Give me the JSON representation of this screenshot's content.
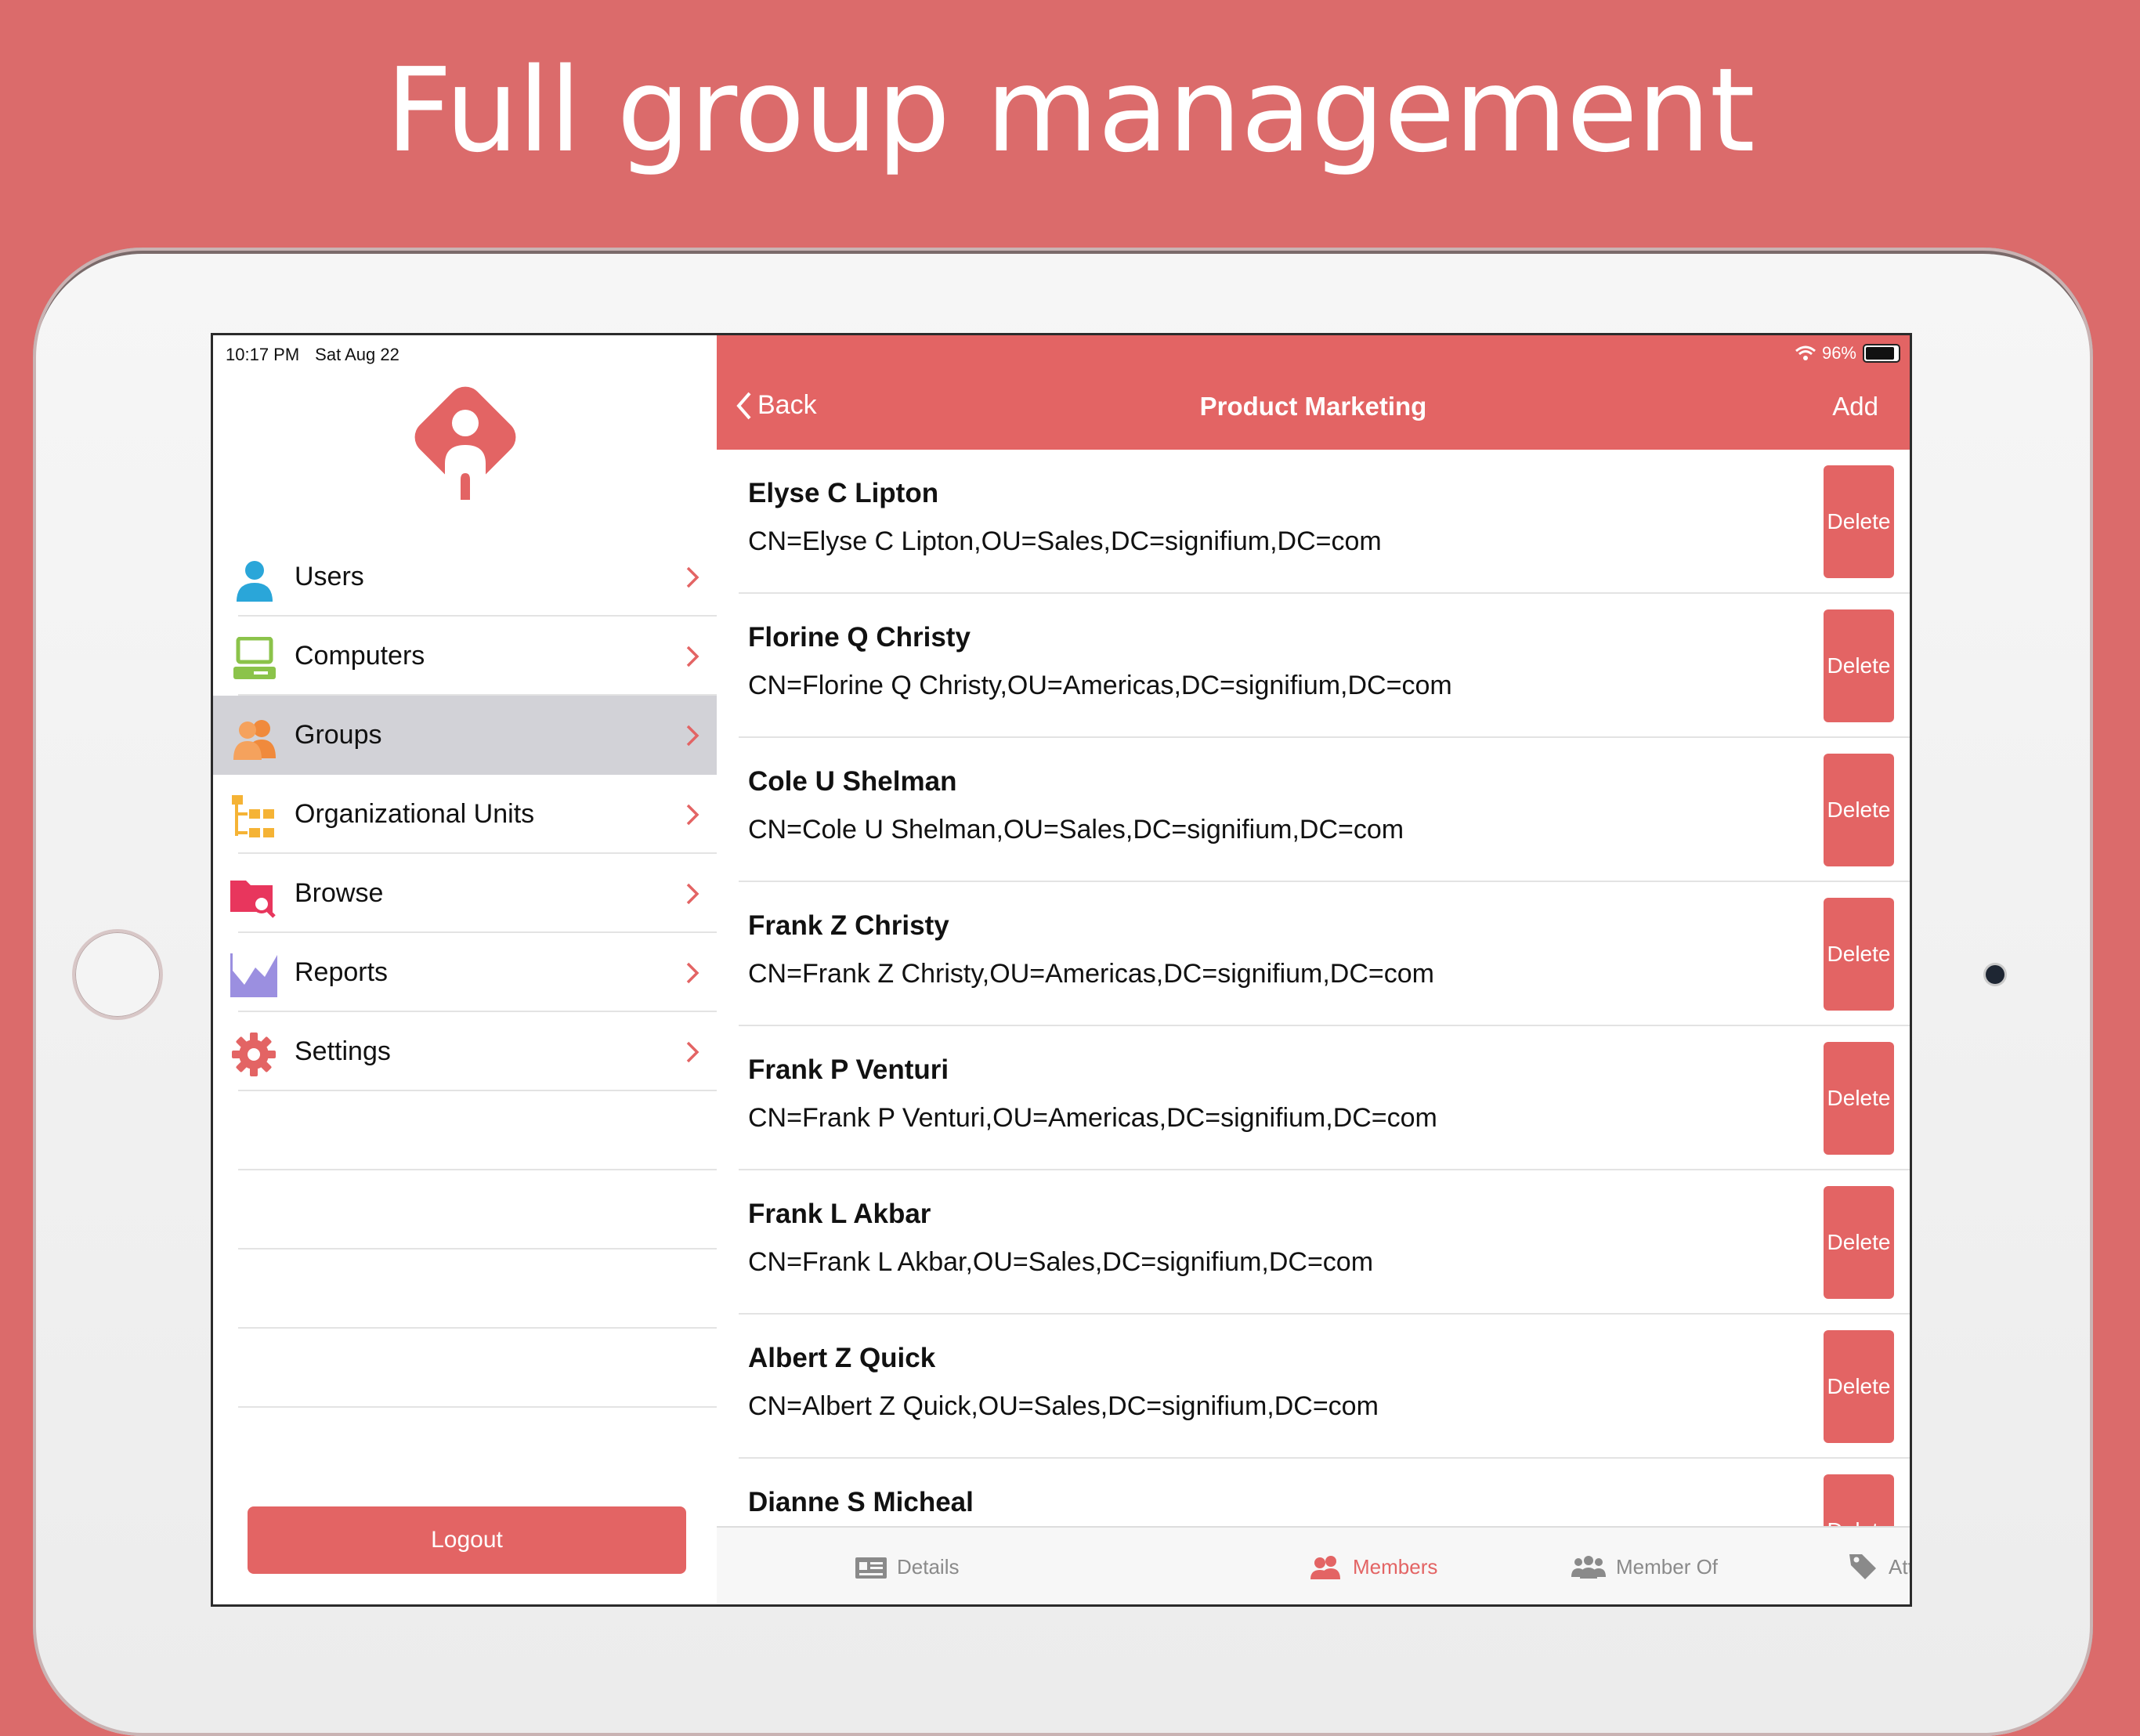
{
  "headline": "Full group management",
  "status": {
    "time": "10:17 PM",
    "date": "Sat Aug 22",
    "battery": "96%"
  },
  "sidebar": {
    "items": [
      {
        "label": "Users",
        "icon": "user-icon",
        "active": false
      },
      {
        "label": "Computers",
        "icon": "computer-icon",
        "active": false
      },
      {
        "label": "Groups",
        "icon": "group-icon",
        "active": true
      },
      {
        "label": "Organizational Units",
        "icon": "org-units-icon",
        "active": false
      },
      {
        "label": "Browse",
        "icon": "browse-folder-icon",
        "active": false
      },
      {
        "label": "Reports",
        "icon": "reports-chart-icon",
        "active": false
      },
      {
        "label": "Settings",
        "icon": "gear-icon",
        "active": false
      }
    ],
    "logout_label": "Logout"
  },
  "navbar": {
    "back_label": "Back",
    "title": "Product Marketing",
    "add_label": "Add"
  },
  "members": [
    {
      "name": "Elyse C Lipton",
      "dn": "CN=Elyse C Lipton,OU=Sales,DC=signifium,DC=com"
    },
    {
      "name": "Florine Q Christy",
      "dn": "CN=Florine Q Christy,OU=Americas,DC=signifium,DC=com"
    },
    {
      "name": "Cole U Shelman",
      "dn": "CN=Cole U Shelman,OU=Sales,DC=signifium,DC=com"
    },
    {
      "name": "Frank Z Christy",
      "dn": "CN=Frank Z Christy,OU=Americas,DC=signifium,DC=com"
    },
    {
      "name": "Frank P Venturi",
      "dn": "CN=Frank P Venturi,OU=Americas,DC=signifium,DC=com"
    },
    {
      "name": "Frank L Akbar",
      "dn": "CN=Frank L Akbar,OU=Sales,DC=signifium,DC=com"
    },
    {
      "name": "Albert Z Quick",
      "dn": "CN=Albert Z Quick,OU=Sales,DC=signifium,DC=com"
    },
    {
      "name": "Dianne S Micheal",
      "dn": ""
    }
  ],
  "delete_label": "Delete",
  "tabs": [
    {
      "label": "Details",
      "icon": "details-card-icon",
      "active": false
    },
    {
      "label": "Members",
      "icon": "members-icon",
      "active": true
    },
    {
      "label": "Member Of",
      "icon": "member-of-icon",
      "active": false
    },
    {
      "label": "Attributes",
      "icon": "tag-icon",
      "active": false
    }
  ],
  "colors": {
    "accent": "#e36464",
    "background": "#db6b6b",
    "active_row": "#d2d2d7"
  }
}
